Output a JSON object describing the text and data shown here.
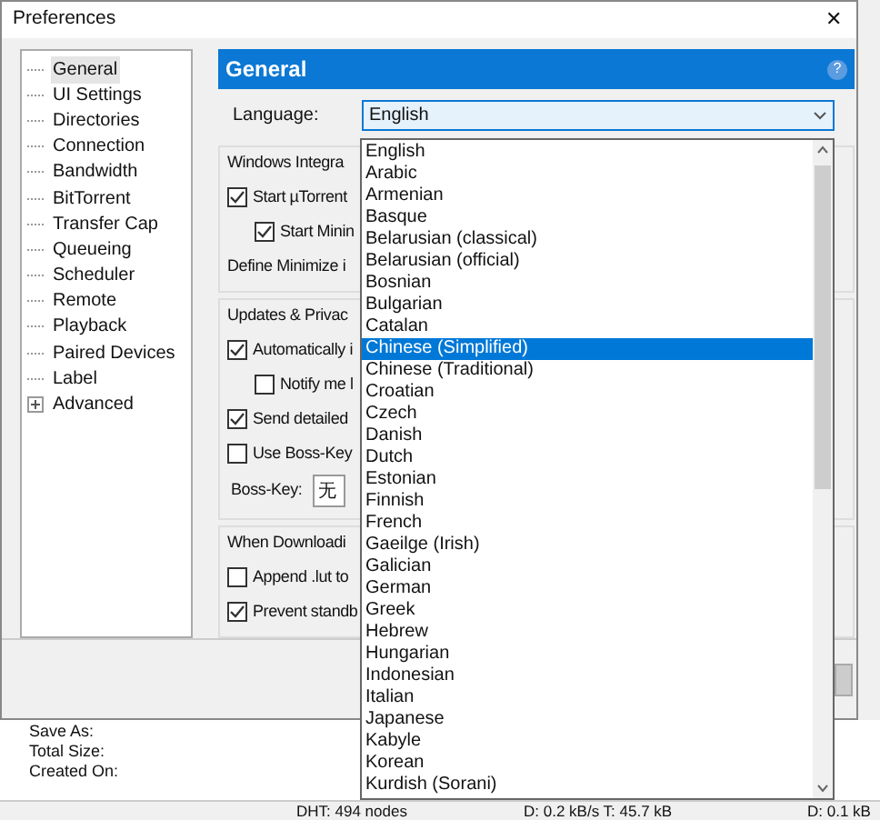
{
  "window": {
    "title": "Preferences",
    "close": "✕"
  },
  "tree": [
    {
      "label": "General",
      "selected": true,
      "expandable": false
    },
    {
      "label": "UI Settings",
      "selected": false,
      "expandable": false
    },
    {
      "label": "Directories",
      "selected": false,
      "expandable": false
    },
    {
      "label": "Connection",
      "selected": false,
      "expandable": false
    },
    {
      "label": "Bandwidth",
      "selected": false,
      "expandable": false
    },
    {
      "label": "BitTorrent",
      "selected": false,
      "expandable": false
    },
    {
      "label": "Transfer Cap",
      "selected": false,
      "expandable": false
    },
    {
      "label": "Queueing",
      "selected": false,
      "expandable": false
    },
    {
      "label": "Scheduler",
      "selected": false,
      "expandable": false
    },
    {
      "label": "Remote",
      "selected": false,
      "expandable": false
    },
    {
      "label": "Playback",
      "selected": false,
      "expandable": false
    },
    {
      "label": "Paired Devices",
      "selected": false,
      "expandable": false
    },
    {
      "label": "Label",
      "selected": false,
      "expandable": false
    },
    {
      "label": "Advanced",
      "selected": false,
      "expandable": true
    }
  ],
  "panel": {
    "title": "General",
    "help": "?",
    "language_label": "Language:",
    "language_value": "English"
  },
  "groups": [
    {
      "title": "Windows Integra",
      "rows": [
        {
          "kind": "checkbox",
          "label": "Start µTorrent",
          "checked": true
        },
        {
          "kind": "subcheckbox",
          "label": "Start Minin",
          "checked": true
        },
        {
          "kind": "text",
          "label": "Define Minimize i"
        }
      ]
    },
    {
      "title": "Updates & Privac",
      "rows": [
        {
          "kind": "checkbox",
          "label": "Automatically i",
          "checked": true
        },
        {
          "kind": "subcheckbox",
          "label": "Notify me l",
          "checked": false
        },
        {
          "kind": "checkbox",
          "label": "Send detailed",
          "checked": true
        },
        {
          "kind": "checkbox",
          "label": "Use Boss-Key",
          "checked": false
        },
        {
          "kind": "field",
          "label": "Boss-Key:",
          "value": "无"
        }
      ]
    },
    {
      "title": "When Downloadi",
      "rows": [
        {
          "kind": "checkbox",
          "label": "Append .lut to",
          "checked": false
        },
        {
          "kind": "checkbox",
          "label": "Prevent standb",
          "checked": true
        }
      ]
    }
  ],
  "dropdown": [
    {
      "label": "English",
      "selected": false
    },
    {
      "label": "Arabic",
      "selected": false
    },
    {
      "label": "Armenian",
      "selected": false
    },
    {
      "label": "Basque",
      "selected": false
    },
    {
      "label": "Belarusian (classical)",
      "selected": false
    },
    {
      "label": "Belarusian (official)",
      "selected": false
    },
    {
      "label": "Bosnian",
      "selected": false
    },
    {
      "label": "Bulgarian",
      "selected": false
    },
    {
      "label": "Catalan",
      "selected": false
    },
    {
      "label": "Chinese (Simplified)",
      "selected": true
    },
    {
      "label": "Chinese (Traditional)",
      "selected": false
    },
    {
      "label": "Croatian",
      "selected": false
    },
    {
      "label": "Czech",
      "selected": false
    },
    {
      "label": "Danish",
      "selected": false
    },
    {
      "label": "Dutch",
      "selected": false
    },
    {
      "label": "Estonian",
      "selected": false
    },
    {
      "label": "Finnish",
      "selected": false
    },
    {
      "label": "French",
      "selected": false
    },
    {
      "label": "Gaeilge (Irish)",
      "selected": false
    },
    {
      "label": "Galician",
      "selected": false
    },
    {
      "label": "German",
      "selected": false
    },
    {
      "label": "Greek",
      "selected": false
    },
    {
      "label": "Hebrew",
      "selected": false
    },
    {
      "label": "Hungarian",
      "selected": false
    },
    {
      "label": "Indonesian",
      "selected": false
    },
    {
      "label": "Italian",
      "selected": false
    },
    {
      "label": "Japanese",
      "selected": false
    },
    {
      "label": "Kabyle",
      "selected": false
    },
    {
      "label": "Korean",
      "selected": false
    },
    {
      "label": "Kurdish (Sorani)",
      "selected": false
    }
  ],
  "details": [
    "Save As:",
    "Total Size:",
    "Created On:"
  ],
  "status_bar": [
    "DHT: 494 nodes",
    "D: 0.2 kB/s T: 45.7 kB",
    "D: 0.1 kB"
  ]
}
